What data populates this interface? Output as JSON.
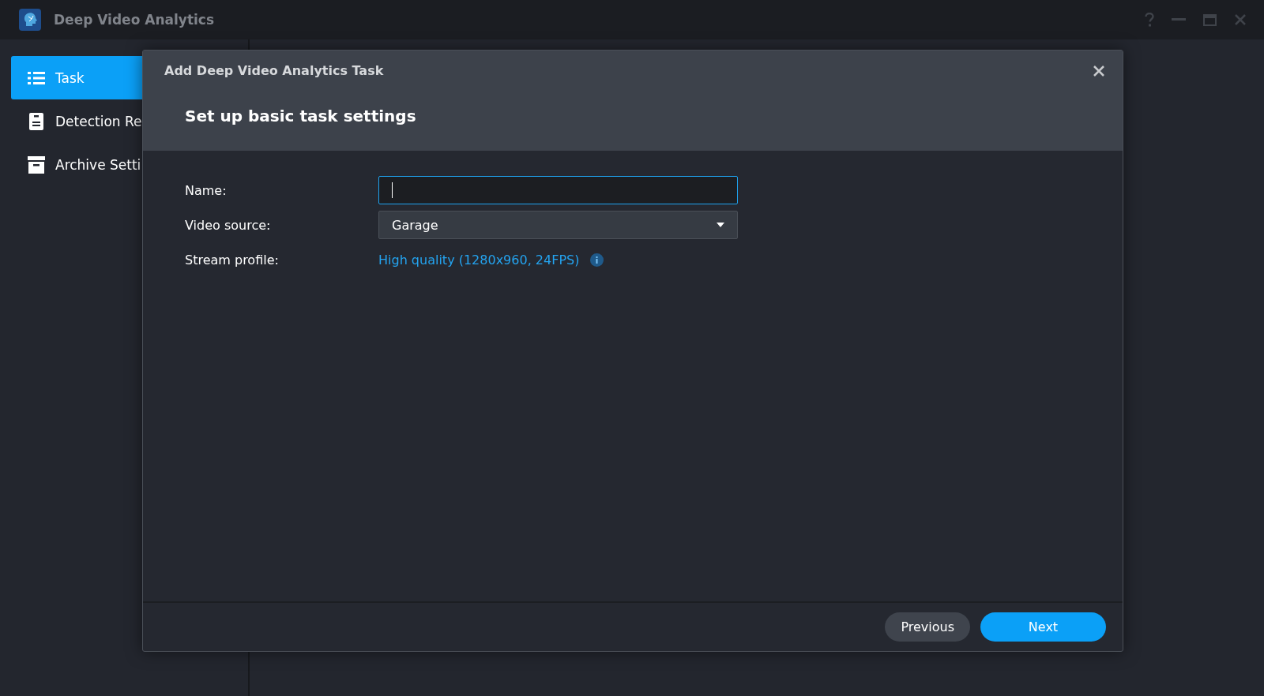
{
  "window": {
    "title": "Deep Video Analytics"
  },
  "sidebar": {
    "items": [
      {
        "label": "Task",
        "kind": "list",
        "selected": true
      },
      {
        "label": "Detection Re",
        "kind": "document",
        "selected": false
      },
      {
        "label": "Archive Setti",
        "kind": "archive",
        "selected": false
      }
    ]
  },
  "dialog": {
    "title": "Add Deep Video Analytics Task",
    "heading": "Set up basic task settings",
    "fields": [
      {
        "label": "Name:",
        "kind": "text",
        "focused": true
      },
      {
        "label": "Video source:",
        "kind": "select",
        "value": "Garage"
      },
      {
        "label": "Stream profile:",
        "kind": "link",
        "value": "High quality (1280x960, 24FPS)"
      }
    ],
    "buttons": [
      {
        "label": "Previous",
        "kind": "secondary"
      },
      {
        "label": "Next",
        "kind": "primary"
      }
    ]
  }
}
